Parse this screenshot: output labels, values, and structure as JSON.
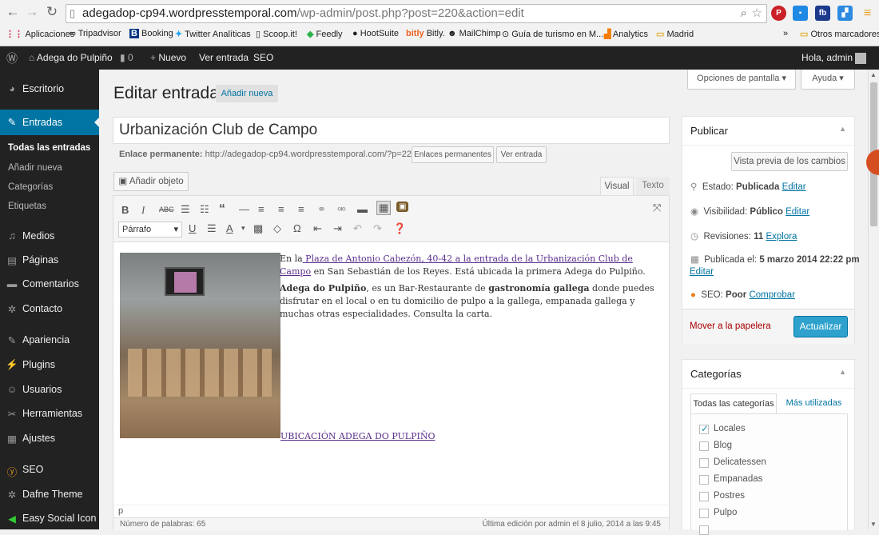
{
  "browser": {
    "url_main": "adegadop-cp94.wordpresstemporal.com",
    "url_path": "/wp-admin/post.php?post=220&action=edit",
    "bookmarks": [
      "Aplicaciones",
      "Tripadvisor",
      "Booking",
      "Twitter Analíticas",
      "Scoop.it!",
      "Feedly",
      "HootSuite",
      "Bitly.",
      "MailChimp",
      "Guía de turismo en M...",
      "Analytics",
      "Madrid"
    ],
    "more": "»",
    "other_bookmarks": "Otros marcadores",
    "ext_fb": "fb"
  },
  "adminbar": {
    "site": "Adega do Pulpiño",
    "comments": "0",
    "new": "Nuevo",
    "view": "Ver entrada",
    "seo": "SEO",
    "greeting": "Hola, admin"
  },
  "sidebar": {
    "items": [
      "Escritorio",
      "Entradas",
      "Medios",
      "Páginas",
      "Comentarios",
      "Contacto",
      "Apariencia",
      "Plugins",
      "Usuarios",
      "Herramientas",
      "Ajustes",
      "SEO",
      "Dafne Theme",
      "Easy Social Icon"
    ],
    "sub": [
      "Todas las entradas",
      "Añadir nueva",
      "Categorías",
      "Etiquetas"
    ]
  },
  "header": {
    "title": "Editar entrada",
    "add_new": "Añadir nueva",
    "screen_options": "Opciones de pantalla",
    "help": "Ayuda"
  },
  "post": {
    "title": "Urbanización Club de Campo",
    "permalink_label": "Enlace permanente:",
    "permalink_url": "http://adegadop-cp94.wordpresstemporal.com/?p=220",
    "permalinks_btn": "Enlaces permanentes",
    "view_btn": "Ver entrada",
    "add_media": "Añadir objeto",
    "tab_visual": "Visual",
    "tab_text": "Texto",
    "format": "Párrafo",
    "p1_a": "En la",
    "p1_link": " Plaza de Antonio Cabezón, 40-42 a la entrada de la Urbanización Club de Campo",
    "p1_b": " en San Sebastián de los Reyes. Está ubicada la primera Adega do Pulpiño.",
    "p2_bold1": "Adega do Pulpiño",
    "p2_a": ", es un Bar-Restaurante de ",
    "p2_bold2": "gastronomía gallega",
    "p2_b": " donde puedes disfrutar en el local o en tu domicilio de pulpo a la gallega, empanada gallega y muchas otras especialidades. Consulta la carta.",
    "location_link": "UBICACIÓN ADEGA DO PULPIÑO",
    "path": "p",
    "word_count": "Número de palabras: 65",
    "last_edit": "Última edición por admin el 8 julio, 2014 a las 9:45"
  },
  "publish": {
    "title": "Publicar",
    "preview": "Vista previa de los cambios",
    "status": "Estado: ",
    "status_val": "Publicada",
    "visibility": "Visibilidad: ",
    "visibility_val": "Público",
    "revisions": "Revisiones: ",
    "revisions_val": "11",
    "explore": "Explora",
    "published": "Publicada el: ",
    "published_val": "5 marzo 2014 22:22 pm",
    "edit": "Editar",
    "seo": "SEO: ",
    "seo_val": "Poor",
    "check": "Comprobar",
    "trash": "Mover a la papelera",
    "update": "Actualizar"
  },
  "categories": {
    "title": "Categorías",
    "tab_all": "Todas las categorías",
    "tab_used": "Más utilizadas",
    "items": [
      "Locales",
      "Blog",
      "Delicatessen",
      "Empanadas",
      "Postres",
      "Pulpo"
    ]
  },
  "colors": {
    "accent": "#0074a2",
    "adminbar": "#222222",
    "update": "#2ea2cc"
  }
}
